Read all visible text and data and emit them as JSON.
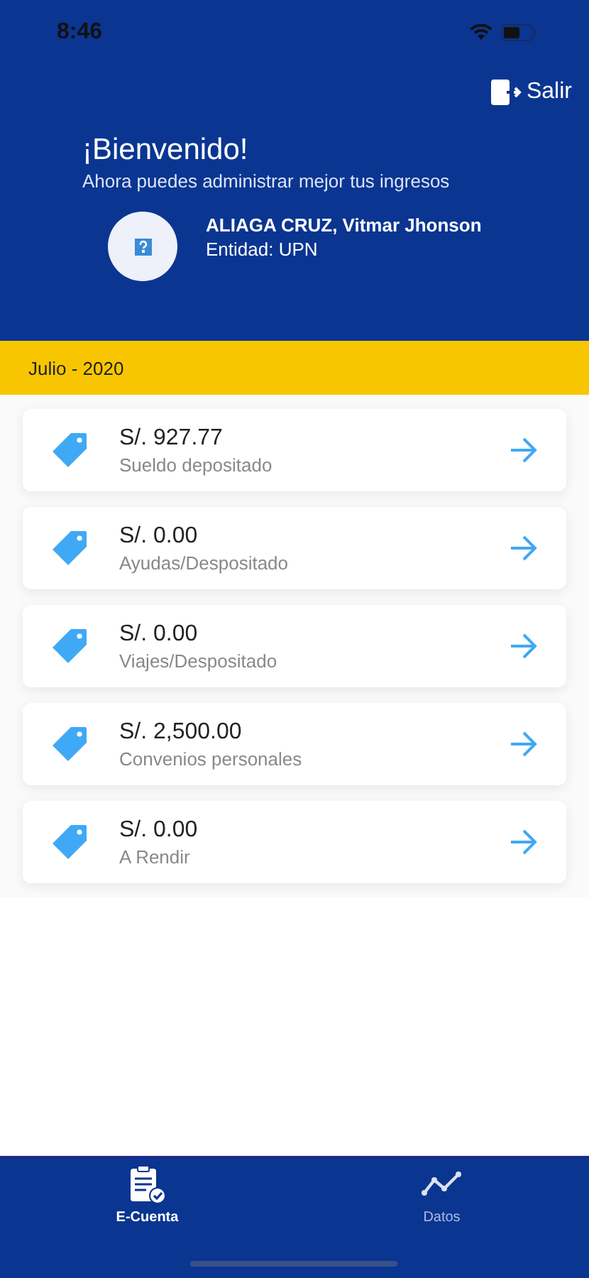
{
  "status_bar": {
    "time": "8:46"
  },
  "header": {
    "logout": "Salir",
    "title": "¡Bienvenido!",
    "subtitle": "Ahora puedes administrar mejor tus ingresos",
    "user": {
      "name": "ALIAGA CRUZ, Vitmar Jhonson",
      "entity": "Entidad: UPN"
    }
  },
  "period": "Julio - 2020",
  "items": [
    {
      "amount": "S/. 927.77",
      "label": "Sueldo depositado"
    },
    {
      "amount": "S/. 0.00",
      "label": "Ayudas/Despositado"
    },
    {
      "amount": "S/. 0.00",
      "label": "Viajes/Despositado"
    },
    {
      "amount": "S/. 2,500.00",
      "label": "Convenios personales"
    },
    {
      "amount": "S/. 0.00",
      "label": "A Rendir"
    }
  ],
  "tabs": [
    {
      "label": "E-Cuenta",
      "kind": "account",
      "selected": true
    },
    {
      "label": "Datos",
      "kind": "chart",
      "selected": false
    }
  ]
}
